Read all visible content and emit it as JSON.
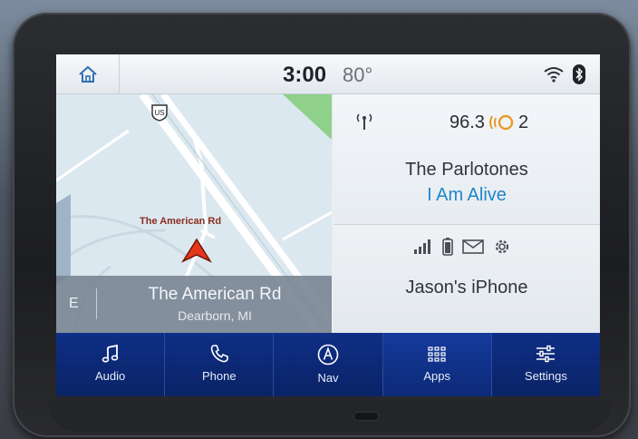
{
  "status_bar": {
    "home_icon": "home-icon",
    "time": "3:00",
    "temperature": "80°",
    "wifi_icon": "wifi-icon",
    "bluetooth_icon": "bluetooth-icon"
  },
  "map": {
    "road_label": "The American Rd",
    "shield_icon": "us-route-shield-icon",
    "position_icon": "navigation-arrow-icon",
    "heading": "E",
    "current_road": "The American Rd",
    "city": "Dearborn, MI"
  },
  "radio": {
    "antenna_icon": "antenna-icon",
    "frequency": "96.3",
    "hd_icon": "hd-radio-icon",
    "hd_channel": "2",
    "artist": "The Parlotones",
    "song": "I Am Alive",
    "song_color": "#1f86c8"
  },
  "phone": {
    "icons": [
      "signal-strength-icon",
      "battery-icon",
      "message-icon",
      "settings-gear-icon"
    ],
    "device_name": "Jason's iPhone"
  },
  "nav": {
    "items": [
      {
        "label": "Audio",
        "icon": "music-note-icon"
      },
      {
        "label": "Phone",
        "icon": "phone-icon"
      },
      {
        "label": "Nav",
        "icon": "navigation-icon"
      },
      {
        "label": "Apps",
        "icon": "apps-grid-icon"
      },
      {
        "label": "Settings",
        "icon": "sliders-icon"
      }
    ],
    "bar_color": "#0f2f86"
  }
}
